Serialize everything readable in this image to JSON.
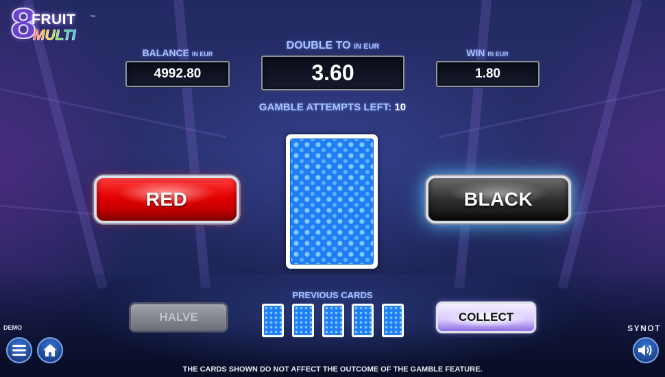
{
  "logo": {
    "eight": "8",
    "fruit": "FRUIT",
    "multi": "MULTI",
    "tm": "™"
  },
  "panels": {
    "balance": {
      "label": "BALANCE",
      "unit": "IN EUR",
      "value": "4992.80"
    },
    "double_to": {
      "label": "DOUBLE TO",
      "unit": "IN EUR",
      "value": "3.60"
    },
    "win": {
      "label": "WIN",
      "unit": "IN EUR",
      "value": "1.80"
    }
  },
  "attempts": {
    "label": "GAMBLE ATTEMPTS LEFT:",
    "value": "10"
  },
  "buttons": {
    "red": "RED",
    "black": "BLACK",
    "halve": "HALVE",
    "collect": "COLLECT"
  },
  "previous_cards": {
    "label": "PREVIOUS CARDS",
    "count": 5
  },
  "footer": {
    "demo": "DEMO",
    "brand": "SYNOT",
    "disclaimer": "THE CARDS SHOWN DO NOT AFFECT THE OUTCOME OF THE GAMBLE FEATURE."
  },
  "icons": {
    "menu": "menu-icon",
    "home": "home-icon",
    "sound": "speaker-icon"
  },
  "colors": {
    "label_blue": "#a9c3ff",
    "red_button": "#e30000",
    "black_button_glow": "#5ac8ff",
    "card_blue": "#1f7df5"
  }
}
